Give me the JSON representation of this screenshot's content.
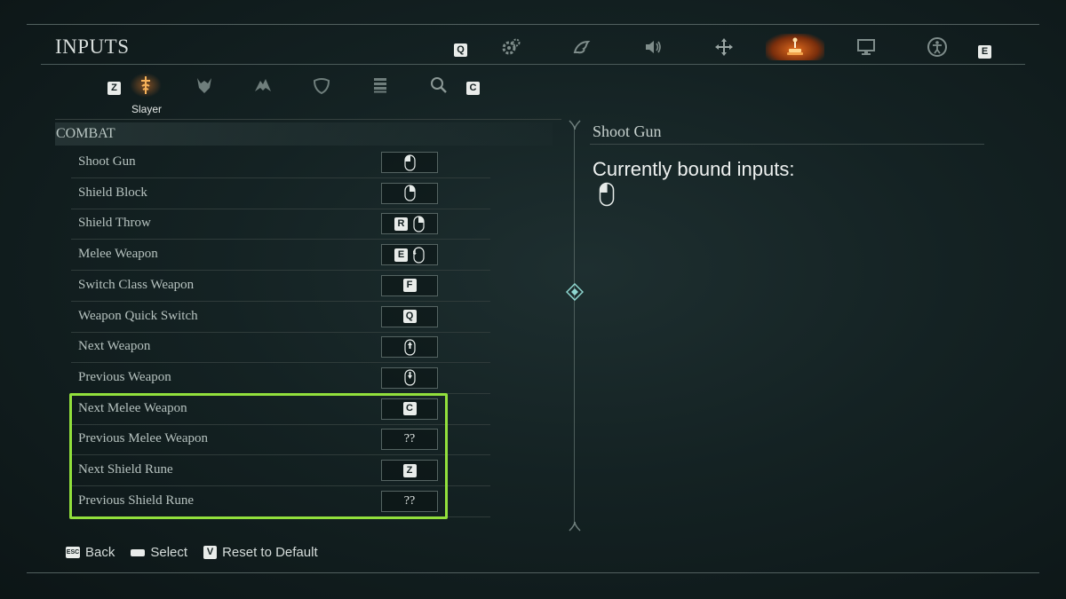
{
  "header": {
    "title": "INPUTS",
    "prev_key": "Q",
    "next_key": "E",
    "categories": [
      {
        "icon": "gear-icon"
      },
      {
        "icon": "dragon-icon"
      },
      {
        "icon": "speaker-icon"
      },
      {
        "icon": "move-arrows-icon"
      },
      {
        "icon": "joystick-icon",
        "active": true
      },
      {
        "icon": "monitor-icon"
      },
      {
        "icon": "accessibility-icon"
      }
    ]
  },
  "subtabs": {
    "prev_key": "Z",
    "next_key": "C",
    "active_label": "Slayer",
    "items": [
      {
        "icon": "slayer-sword-icon",
        "active": true
      },
      {
        "icon": "demon-helmet-icon"
      },
      {
        "icon": "dragon-wing-icon"
      },
      {
        "icon": "shield-icon"
      },
      {
        "icon": "list-icon"
      },
      {
        "icon": "magnifier-icon"
      }
    ]
  },
  "combat": {
    "title": "COMBAT",
    "rows": [
      {
        "label": "Shoot Gun",
        "keys": [],
        "mouse": "left"
      },
      {
        "label": "Shield Block",
        "keys": [],
        "mouse": "right"
      },
      {
        "label": "Shield Throw",
        "keys": [
          "R"
        ],
        "mouse": "right"
      },
      {
        "label": "Melee Weapon",
        "keys": [
          "E"
        ],
        "mouse": "4"
      },
      {
        "label": "Switch Class Weapon",
        "keys": [
          "F"
        ],
        "mouse": ""
      },
      {
        "label": "Weapon Quick Switch",
        "keys": [
          "Q"
        ],
        "mouse": ""
      },
      {
        "label": "Next Weapon",
        "keys": [],
        "mouse": "wheel-up"
      },
      {
        "label": "Previous Weapon",
        "keys": [],
        "mouse": "wheel-down"
      },
      {
        "label": "Next Melee Weapon",
        "keys": [
          "C"
        ],
        "mouse": ""
      },
      {
        "label": "Previous Melee Weapon",
        "keys": [],
        "mouse": "",
        "text": "??"
      },
      {
        "label": "Next Shield Rune",
        "keys": [
          "Z"
        ],
        "mouse": ""
      },
      {
        "label": "Previous Shield Rune",
        "keys": [],
        "mouse": "",
        "text": "??"
      }
    ]
  },
  "detail": {
    "title": "Shoot Gun",
    "subtitle": "Currently bound inputs:"
  },
  "footer": {
    "back_key": "ESC",
    "back_label": "Back",
    "select_label": "Select",
    "reset_key": "V",
    "reset_label": "Reset to Default"
  },
  "colors": {
    "highlight": "#92e03c",
    "accent": "#e06a1c"
  }
}
